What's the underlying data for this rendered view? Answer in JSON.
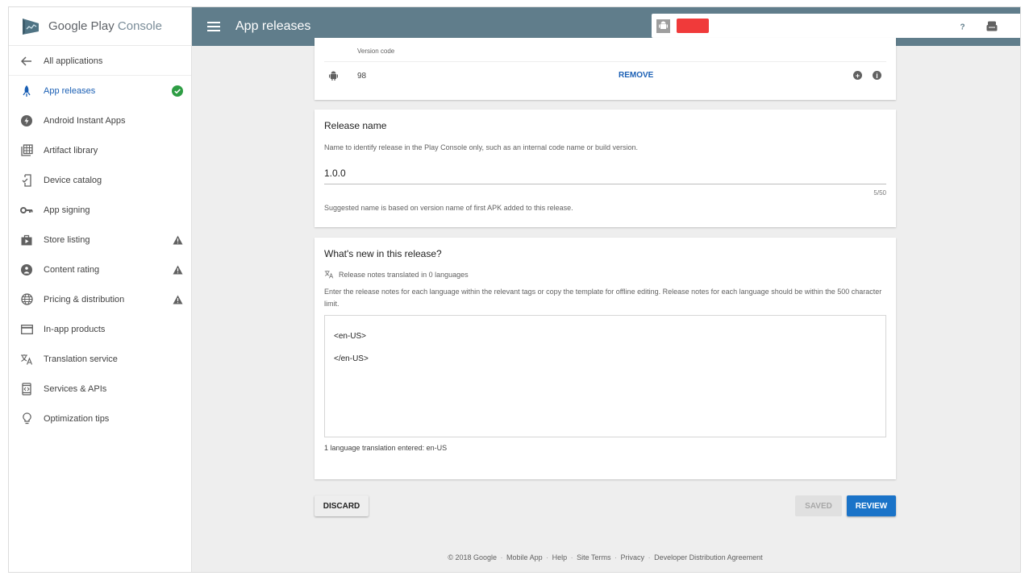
{
  "brand": {
    "google_play": "Google Play",
    "console": "Console"
  },
  "header": {
    "title": "App releases"
  },
  "app_selector": {
    "selected_app_name": ""
  },
  "sidebar": {
    "back_label": "All applications",
    "items": [
      {
        "label": "App releases",
        "icon": "rocket-icon",
        "status": "complete",
        "active": true
      },
      {
        "label": "Android Instant Apps",
        "icon": "instant-apps-icon",
        "status": null
      },
      {
        "label": "Artifact library",
        "icon": "library-icon",
        "status": null
      },
      {
        "label": "Device catalog",
        "icon": "device-icon",
        "status": null
      },
      {
        "label": "App signing",
        "icon": "key-icon",
        "status": null
      },
      {
        "label": "Store listing",
        "icon": "shop-icon",
        "status": "warning"
      },
      {
        "label": "Content rating",
        "icon": "rating-icon",
        "status": "warning"
      },
      {
        "label": "Pricing & distribution",
        "icon": "globe-icon",
        "status": "warning"
      },
      {
        "label": "In-app products",
        "icon": "card-icon",
        "status": null
      },
      {
        "label": "Translation service",
        "icon": "translate-icon",
        "status": null
      },
      {
        "label": "Services & APIs",
        "icon": "api-icon",
        "status": null
      },
      {
        "label": "Optimization tips",
        "icon": "lightbulb-icon",
        "status": null
      }
    ]
  },
  "apk_card": {
    "version_code_label": "Version code",
    "version_code": "98",
    "remove_label": "REMOVE"
  },
  "release_name_card": {
    "title": "Release name",
    "description": "Name to identify release in the Play Console only, such as an internal code name or build version.",
    "value": "1.0.0",
    "char_count": "5/50",
    "hint": "Suggested name is based on version name of first APK added to this release."
  },
  "whats_new_card": {
    "title": "What's new in this release?",
    "translated_status": "Release notes translated in 0 languages",
    "description": "Enter the release notes for each language within the relevant tags or copy the template for offline editing. Release notes for each language should be within the 500 character limit.",
    "notes_value": "<en-US>\n</en-US>",
    "language_count": "1 language translation entered: en-US"
  },
  "actions": {
    "discard": "DISCARD",
    "saved": "SAVED",
    "review": "REVIEW"
  },
  "footer": {
    "copyright": "© 2018 Google",
    "links": [
      "Mobile App",
      "Help",
      "Site Terms",
      "Privacy",
      "Developer Distribution Agreement"
    ]
  },
  "colors": {
    "header": "#607d8b",
    "accent": "#1a73c8",
    "active_nav": "#1a5fb4",
    "success": "#2e9d44",
    "warning": "#616161"
  }
}
